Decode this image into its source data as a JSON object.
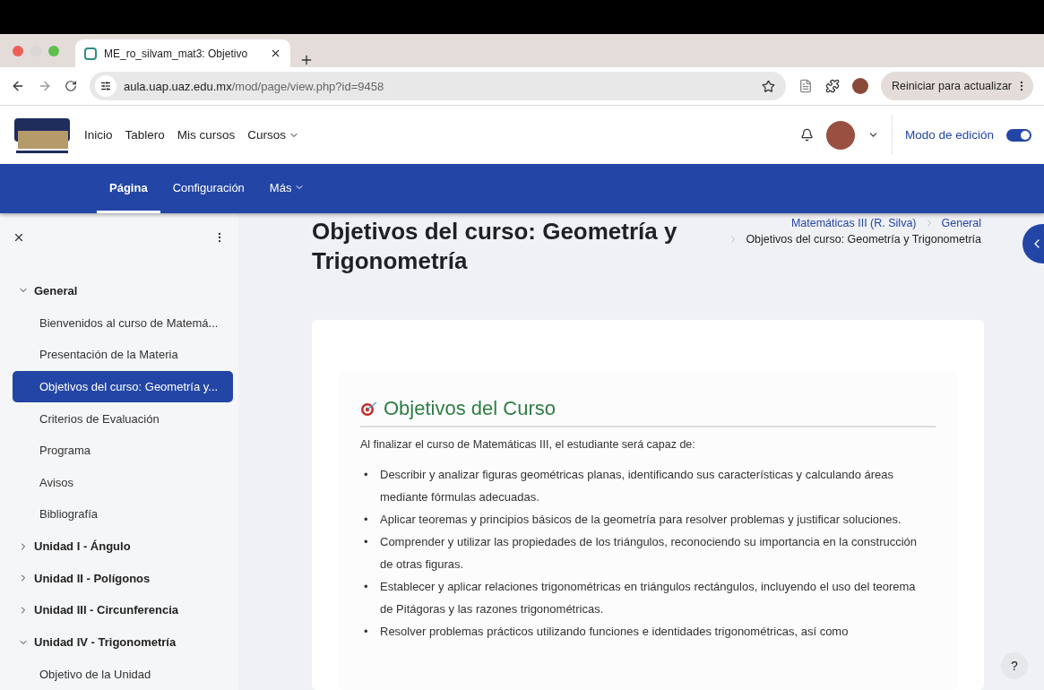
{
  "browser": {
    "tab": {
      "title": "ME_ro_silvam_mat3: Objetivo"
    },
    "url": {
      "host": "aula.uap.uaz.edu.mx",
      "path": "/mod/page/view.php?id=9458"
    },
    "update_button": "Reiniciar para actualizar"
  },
  "header": {
    "nav": [
      {
        "label": "Inicio",
        "dropdown": false
      },
      {
        "label": "Tablero",
        "dropdown": false
      },
      {
        "label": "Mis cursos",
        "dropdown": false
      },
      {
        "label": "Cursos",
        "dropdown": true
      }
    ],
    "edit_mode": {
      "label": "Modo de edición",
      "on": true
    }
  },
  "secondary_nav": [
    {
      "label": "Página",
      "selected": true,
      "dropdown": false
    },
    {
      "label": "Configuración",
      "selected": false,
      "dropdown": false
    },
    {
      "label": "Más",
      "selected": false,
      "dropdown": true
    }
  ],
  "sidebar": {
    "sections": [
      {
        "title": "General",
        "expanded": true,
        "items": [
          {
            "label": "Bienvenidos al curso de Matemá...",
            "selected": false
          },
          {
            "label": "Presentación de la Materia",
            "selected": false
          },
          {
            "label": "Objetivos del curso: Geometría y...",
            "selected": true
          },
          {
            "label": "Criterios de Evaluación",
            "selected": false
          },
          {
            "label": "Programa",
            "selected": false
          },
          {
            "label": "Avisos",
            "selected": false
          },
          {
            "label": "Bibliografía",
            "selected": false
          }
        ]
      },
      {
        "title": "Unidad I - Ángulo",
        "expanded": false
      },
      {
        "title": "Unidad II - Polígonos",
        "expanded": false
      },
      {
        "title": "Unidad III - Circunferencia",
        "expanded": false
      },
      {
        "title": "Unidad IV - Trigonometría",
        "expanded": true,
        "items": [
          {
            "label": "Objetivo de la Unidad",
            "selected": false
          }
        ]
      }
    ]
  },
  "page": {
    "title": "Objetivos del curso: Geometría y Trigonometría",
    "breadcrumb": [
      "Matemáticas III (R. Silva)",
      "General",
      "Objetivos del curso: Geometría y Trigonometría"
    ],
    "content": {
      "bullet": "•",
      "heading": "Objetivos del Curso",
      "intro": "Al finalizar el curso de Matemáticas III, el estudiante será capaz de:",
      "objectives": [
        "Describir y analizar figuras geométricas planas, identificando sus características y calculando áreas mediante fórmulas adecuadas.",
        "Aplicar teoremas y principios básicos de la geometría para resolver problemas y justificar soluciones.",
        "Comprender y utilizar las propiedades de los triángulos, reconociendo su importancia en la construcción de otras figuras.",
        "Establecer y aplicar relaciones trigonométricas en triángulos rectángulos, incluyendo el uso del teorema de Pitágoras y las razones trigonométricas.",
        "Resolver problemas prácticos utilizando funciones e identidades trigonométricas, así como"
      ]
    }
  },
  "help_button": "?"
}
